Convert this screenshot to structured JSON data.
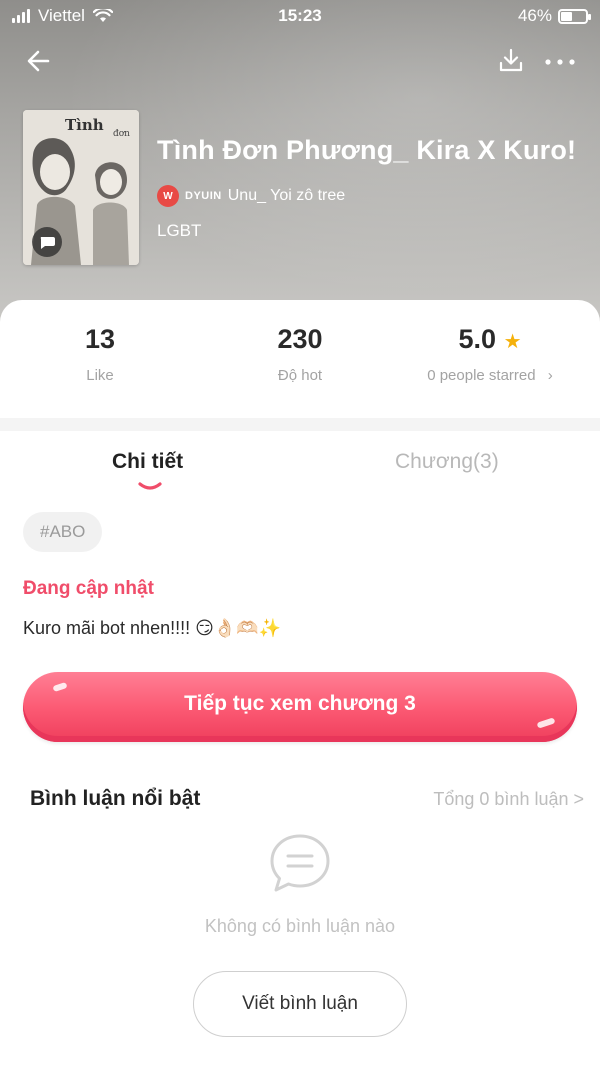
{
  "status_bar": {
    "carrier": "Viettel",
    "time": "15:23",
    "battery": "46%",
    "battery_level": 0.46
  },
  "nav": {
    "back_icon": "arrow-left-icon",
    "download_icon": "download-icon",
    "more_icon": "more-dots-icon"
  },
  "story": {
    "title": "Tình Đơn Phương_ Kira X Kuro!",
    "author_prefix": "DYUIN",
    "author_name": "Unu_ Yoi zô tree",
    "genre": "LGBT",
    "cover_badge_icon": "chat-bubble-icon"
  },
  "stats": {
    "likes_value": "13",
    "likes_label": "Like",
    "hot_value": "230",
    "hot_label": "Độ hot",
    "rating_value": "5.0",
    "rating_label": "0 people starred",
    "rating_chevron": "›"
  },
  "tabs": {
    "detail": "Chi tiết",
    "chapters": "Chương(3)"
  },
  "tag": "#ABO",
  "update_status": "Đang cập nhật",
  "description": "Kuro mãi bot nhen!!!! 😏👌🏻🫶🏻✨",
  "continue_button": "Tiếp tục xem chương 3",
  "comments": {
    "title": "Bình luận nổi bật",
    "total": "Tổng 0 bình luận >",
    "empty_text": "Không có bình luận nào",
    "write_button": "Viết bình luận"
  },
  "colors": {
    "accent": "#f04d6a",
    "button": "#fb5872",
    "star": "#f5b10b"
  }
}
